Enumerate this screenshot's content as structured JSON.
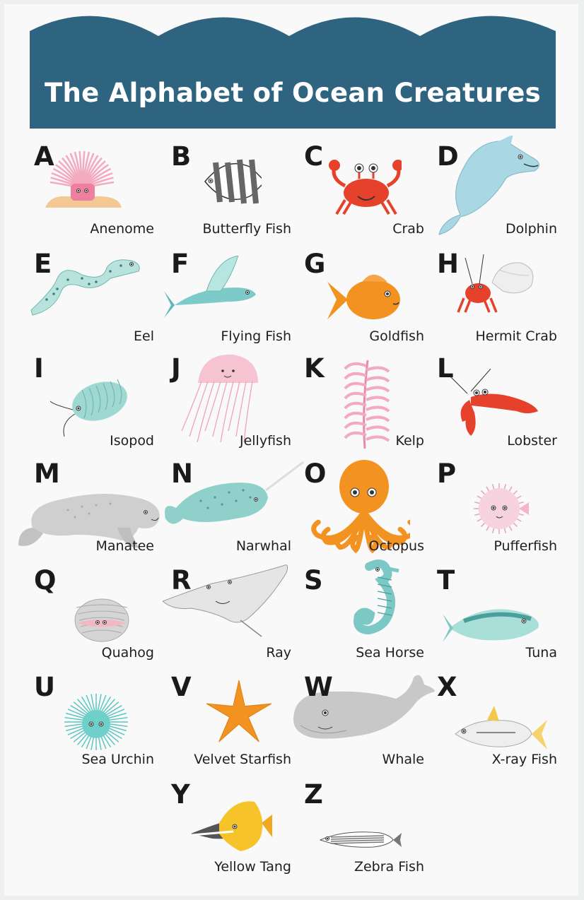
{
  "title": "The Alphabet of Ocean Creatures",
  "colors": {
    "banner": "#2f6480",
    "ink": "#1a1a1a",
    "mint": "#9fd8d2",
    "orange": "#f29220",
    "red": "#e5412b",
    "pink": "#f3a9c0",
    "gray": "#c4c4c4"
  },
  "creatures": [
    {
      "letter": "A",
      "name": "Anenome",
      "icon": "sea-anemone-icon"
    },
    {
      "letter": "B",
      "name": "Butterfly Fish",
      "icon": "butterfly-fish-icon"
    },
    {
      "letter": "C",
      "name": "Crab",
      "icon": "crab-icon"
    },
    {
      "letter": "D",
      "name": "Dolphin",
      "icon": "dolphin-icon"
    },
    {
      "letter": "E",
      "name": "Eel",
      "icon": "eel-icon"
    },
    {
      "letter": "F",
      "name": "Flying Fish",
      "icon": "flying-fish-icon"
    },
    {
      "letter": "G",
      "name": "Goldfish",
      "icon": "goldfish-icon"
    },
    {
      "letter": "H",
      "name": "Hermit Crab",
      "icon": "hermit-crab-icon"
    },
    {
      "letter": "I",
      "name": "Isopod",
      "icon": "isopod-icon"
    },
    {
      "letter": "J",
      "name": "Jellyfish",
      "icon": "jellyfish-icon"
    },
    {
      "letter": "K",
      "name": "Kelp",
      "icon": "kelp-icon"
    },
    {
      "letter": "L",
      "name": "Lobster",
      "icon": "lobster-icon"
    },
    {
      "letter": "M",
      "name": "Manatee",
      "icon": "manatee-icon"
    },
    {
      "letter": "N",
      "name": "Narwhal",
      "icon": "narwhal-icon"
    },
    {
      "letter": "O",
      "name": "Octopus",
      "icon": "octopus-icon"
    },
    {
      "letter": "P",
      "name": "Pufferfish",
      "icon": "pufferfish-icon"
    },
    {
      "letter": "Q",
      "name": "Quahog",
      "icon": "quahog-icon"
    },
    {
      "letter": "R",
      "name": "Ray",
      "icon": "ray-icon"
    },
    {
      "letter": "S",
      "name": "Sea Horse",
      "icon": "sea-horse-icon"
    },
    {
      "letter": "T",
      "name": "Tuna",
      "icon": "tuna-icon"
    },
    {
      "letter": "U",
      "name": "Sea Urchin",
      "icon": "sea-urchin-icon"
    },
    {
      "letter": "V",
      "name": "Velvet Starfish",
      "icon": "starfish-icon"
    },
    {
      "letter": "W",
      "name": "Whale",
      "icon": "whale-icon"
    },
    {
      "letter": "X",
      "name": "X-ray Fish",
      "icon": "x-ray-fish-icon"
    },
    {
      "letter": "Y",
      "name": "Yellow Tang",
      "icon": "yellow-tang-icon"
    },
    {
      "letter": "Z",
      "name": "Zebra Fish",
      "icon": "zebra-fish-icon"
    }
  ]
}
